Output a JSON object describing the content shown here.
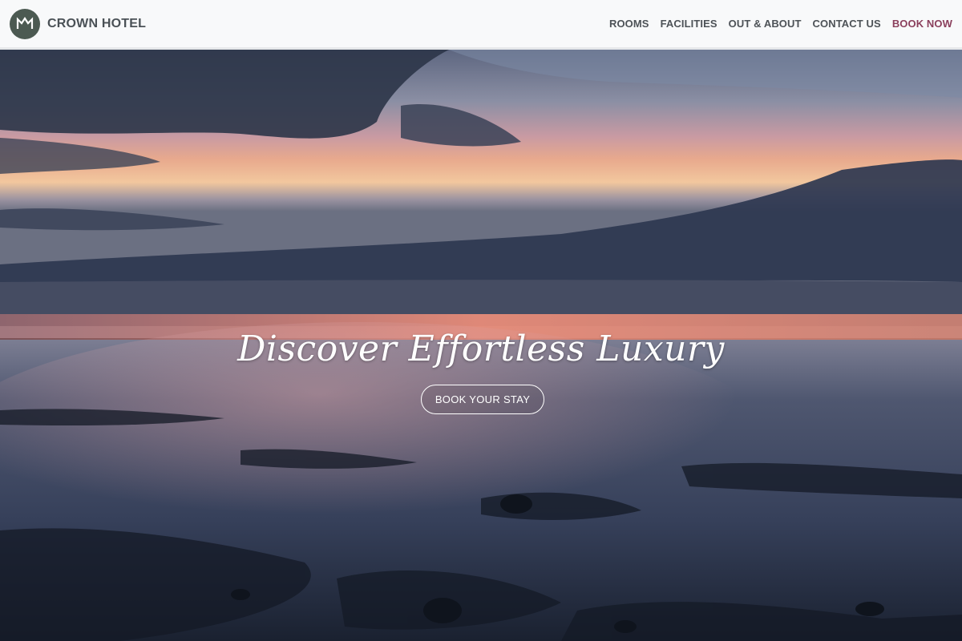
{
  "header": {
    "brand": "CROWN HOTEL",
    "logo_icon": "crown-icon",
    "nav": [
      {
        "label": "ROOMS"
      },
      {
        "label": "FACILITIES"
      },
      {
        "label": "OUT & ABOUT"
      },
      {
        "label": "CONTACT US"
      },
      {
        "label": "BOOK NOW"
      }
    ]
  },
  "hero": {
    "headline": "Discover Effortless Luxury",
    "cta_label": "BOOK YOUR STAY",
    "image": "sunset-beach-photo"
  },
  "colors": {
    "header_bg": "#f8f9fa",
    "nav_text": "#4d5257",
    "book_now": "#8a3f5c",
    "logo_bg": "#4c5a52"
  }
}
